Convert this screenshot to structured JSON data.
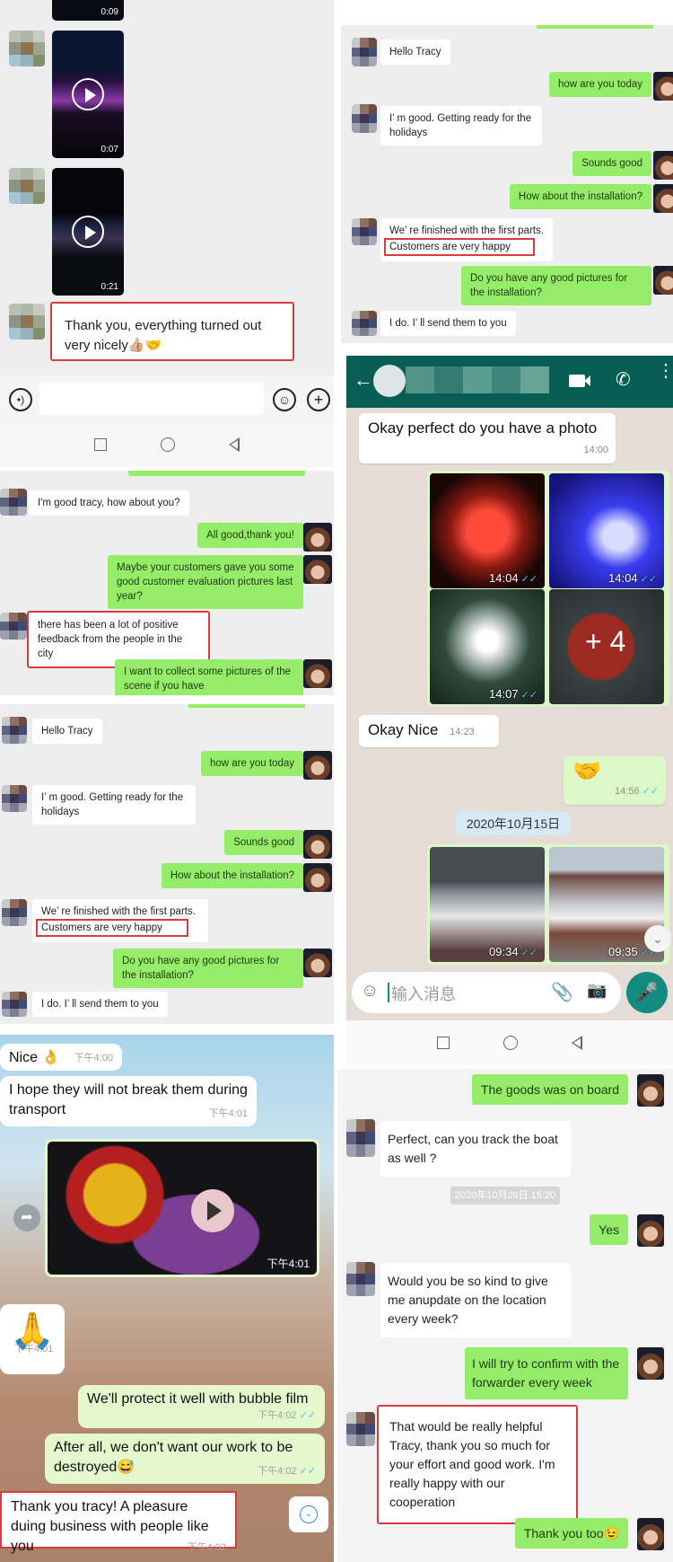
{
  "panel1": {
    "videos": [
      {
        "duration": "0:09"
      },
      {
        "duration": "0:07"
      },
      {
        "duration": "0:21"
      }
    ],
    "highlight_message": "Thank you, everything turned out very nicely👍🏼🤝"
  },
  "panel2": {
    "messages": [
      {
        "dir": "in",
        "text": "I'm good tracy, how about you?"
      },
      {
        "dir": "out",
        "text": "All good,thank you!"
      },
      {
        "dir": "out",
        "text": "Maybe your customers gave you some good customer evaluation pictures last year?"
      },
      {
        "dir": "in",
        "text": "there has been a lot of positive feedback from the people in the city",
        "highlighted": true
      },
      {
        "dir": "out",
        "text": "I want to collect some pictures of the scene if you have"
      }
    ]
  },
  "panel3": {
    "messages": [
      {
        "dir": "in",
        "text": "Hello Tracy"
      },
      {
        "dir": "out",
        "text": "how are you today"
      },
      {
        "dir": "in",
        "text": "I’ m good. Getting ready for the holidays"
      },
      {
        "dir": "out",
        "text": "Sounds good"
      },
      {
        "dir": "out",
        "text": "How about the installation?"
      },
      {
        "dir": "in",
        "text_line1": "We’ re finished with the first parts.",
        "text_line2": "Customers are very happy",
        "highlighted": true
      },
      {
        "dir": "out",
        "text": "Do you have any good pictures for the installation?"
      },
      {
        "dir": "in",
        "text": "I do. I’ ll send them to you"
      }
    ]
  },
  "panel4": {
    "messages": [
      {
        "dir": "in",
        "text": "Nice 👌",
        "time": "下午4:00"
      },
      {
        "dir": "in",
        "text": "I hope they will not break them during transport",
        "time": "下午4:01"
      },
      {
        "dir": "out",
        "type": "video",
        "time": "下午4:01"
      },
      {
        "dir": "in",
        "text": "🙏",
        "time": "下午4:01"
      },
      {
        "dir": "out",
        "text": "We'll protect it well with bubble film",
        "time": "下午4:02"
      },
      {
        "dir": "out",
        "text": "After all, we don't want our work to be destroyed😅",
        "time": "下午4:02"
      },
      {
        "dir": "in",
        "text": "Thank you tracy! A pleasure duing business with people like you",
        "time": "下午4:02",
        "highlighted": true
      }
    ]
  },
  "panel5": {
    "header": {
      "contact_name": "",
      "icons": [
        "back-arrow-icon",
        "video-call-icon",
        "phone-icon",
        "more-icon"
      ]
    },
    "messages": [
      {
        "dir": "in",
        "text": "Okay perfect do you have a photo",
        "time": "14:00"
      },
      {
        "dir": "out",
        "type": "photo-grid",
        "photos": [
          {
            "time": "14:04",
            "color": "#c0281c"
          },
          {
            "time": "14:04",
            "color": "#2a2ee0"
          },
          {
            "time": "14:07",
            "color": "#2b3d33"
          },
          {
            "overlay": "+ 4",
            "color": "#7a2a24"
          }
        ]
      },
      {
        "dir": "in",
        "text": "Okay Nice",
        "time": "14:23"
      },
      {
        "dir": "out",
        "text": "🤝",
        "time": "14:56"
      },
      {
        "type": "date",
        "text": "2020年10月15日"
      },
      {
        "dir": "out",
        "type": "photos",
        "photos": [
          {
            "time": "09:34"
          },
          {
            "time": "09:35"
          }
        ]
      }
    ],
    "input_placeholder": "输入消息"
  },
  "panel6": {
    "messages": [
      {
        "dir": "out",
        "text": "The goods was on board"
      },
      {
        "dir": "in",
        "text": "Perfect, can you track the boat as well ?"
      },
      {
        "type": "date",
        "text": "2020年10月26日 15:20"
      },
      {
        "dir": "out",
        "text": "Yes"
      },
      {
        "dir": "in",
        "text": "Would you be so kind to give me anupdate on the location every week?"
      },
      {
        "dir": "out",
        "text": "I will try to confirm with the forwarder every week"
      },
      {
        "dir": "in",
        "text": "That would be really helpful Tracy, thank you so much for your effort and good work. I'm really happy with our cooperation",
        "highlighted": true
      },
      {
        "dir": "out",
        "text": "Thank you too😉"
      }
    ]
  }
}
